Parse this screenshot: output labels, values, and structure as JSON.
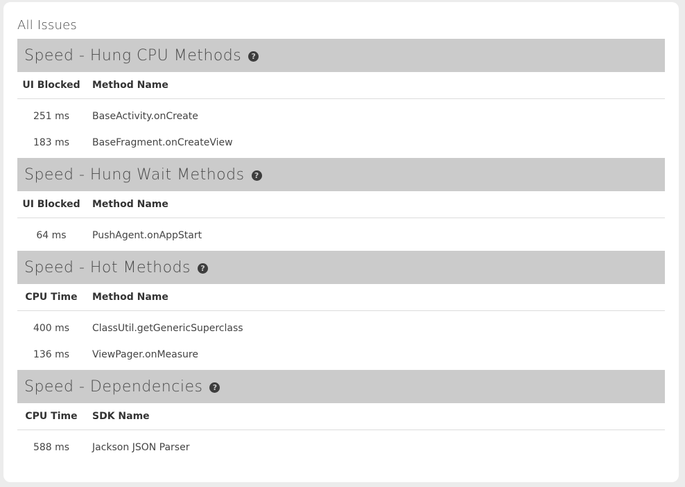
{
  "page": {
    "title": "All Issues",
    "help_glyph": "?"
  },
  "sections": [
    {
      "title": "Speed - Hung CPU Methods",
      "columns": {
        "metric": "UI Blocked",
        "name": "Method Name"
      },
      "rows": [
        {
          "metric": "251 ms",
          "name": "BaseActivity.onCreate"
        },
        {
          "metric": "183 ms",
          "name": "BaseFragment.onCreateView"
        }
      ]
    },
    {
      "title": "Speed - Hung Wait Methods",
      "columns": {
        "metric": "UI Blocked",
        "name": "Method Name"
      },
      "rows": [
        {
          "metric": "64 ms",
          "name": "PushAgent.onAppStart"
        }
      ]
    },
    {
      "title": "Speed - Hot Methods",
      "columns": {
        "metric": "CPU Time",
        "name": "Method Name"
      },
      "rows": [
        {
          "metric": "400 ms",
          "name": "ClassUtil.getGenericSuperclass"
        },
        {
          "metric": "136 ms",
          "name": "ViewPager.onMeasure"
        }
      ]
    },
    {
      "title": "Speed - Dependencies",
      "columns": {
        "metric": "CPU Time",
        "name": "SDK Name"
      },
      "rows": [
        {
          "metric": "588 ms",
          "name": "Jackson JSON Parser"
        }
      ]
    }
  ]
}
